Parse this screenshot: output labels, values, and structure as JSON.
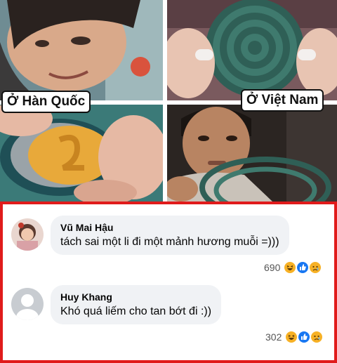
{
  "meme": {
    "caption_left": "Ở Hàn Quốc",
    "caption_right": "Ở Việt Nam"
  },
  "comments": [
    {
      "name": "Vũ Mai Hậu",
      "text": "tách sai một li đi một mảnh hương muỗi =)))",
      "reaction_count": "690",
      "reactions": [
        "haha-icon",
        "like-icon",
        "sad-icon"
      ]
    },
    {
      "name": "Huy Khang",
      "text": "Khó quá liếm cho tan bớt đi :))",
      "reaction_count": "302",
      "reactions": [
        "haha-icon",
        "like-icon",
        "sad-icon"
      ]
    }
  ],
  "colors": {
    "frame_border": "#e01b1b",
    "bubble_bg": "#f0f2f5",
    "like_blue": "#1877f2",
    "haha_yellow": "#f7b125"
  }
}
